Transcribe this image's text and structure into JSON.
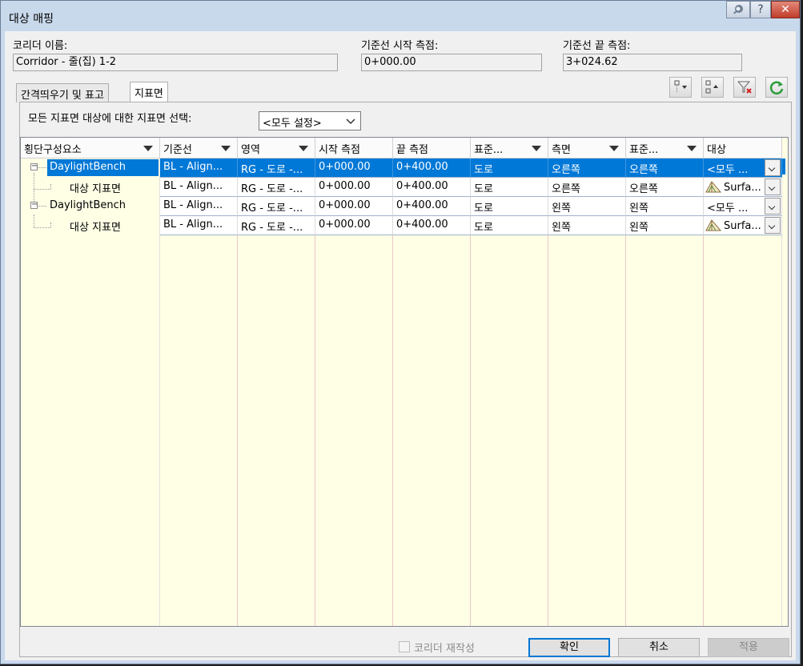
{
  "window": {
    "title": "대상 매핑",
    "help_button": "?",
    "close_button": "✕"
  },
  "fields": {
    "corridor_name_label": "코리더 이름:",
    "corridor_name_value": "Corridor - 줄(집) 1-2",
    "start_station_label": "기준선 시작 측점:",
    "start_station_value": "0+000.00",
    "end_station_label": "기준선 끝 측점:",
    "end_station_value": "3+024.62"
  },
  "tabs": [
    {
      "label": "간격띄우기 및 표고"
    },
    {
      "label": "지표면"
    }
  ],
  "toolbar": {
    "icons": [
      "expand-tree-icon",
      "collapse-tree-icon",
      "clear-filter-icon",
      "refresh-icon"
    ]
  },
  "surface_select": {
    "label": "모든 지표면 대상에 대한 지표면 선택:",
    "value": "<모두 설정>"
  },
  "grid": {
    "columns": [
      "횡단구성요소",
      "기준선",
      "영역",
      "시작 측점",
      "끝 측점",
      "표준...",
      "측면",
      "표준...",
      "대상"
    ],
    "rows": [
      {
        "level": 0,
        "name": "DaylightBench",
        "baseline": "BL - Align...",
        "region": "RG - 도로 -...",
        "start": "0+000.00",
        "end": "0+400.00",
        "assembly": "도로",
        "side": "오른쪽",
        "subassembly_side": "오른쪽",
        "target": "<모두 ...",
        "target_icon": false,
        "selected": true
      },
      {
        "level": 1,
        "name": "대상 지표면",
        "baseline": "BL - Align...",
        "region": "RG - 도로 -...",
        "start": "0+000.00",
        "end": "0+400.00",
        "assembly": "도로",
        "side": "오른쪽",
        "subassembly_side": "오른쪽",
        "target": "Surfa...",
        "target_icon": true,
        "selected": false
      },
      {
        "level": 0,
        "name": "DaylightBench",
        "baseline": "BL - Align...",
        "region": "RG - 도로 -...",
        "start": "0+000.00",
        "end": "0+400.00",
        "assembly": "도로",
        "side": "왼쪽",
        "subassembly_side": "왼쪽",
        "target": "<모두 ...",
        "target_icon": false,
        "selected": false
      },
      {
        "level": 1,
        "name": "대상 지표면",
        "baseline": "BL - Align...",
        "region": "RG - 도로 -...",
        "start": "0+000.00",
        "end": "0+400.00",
        "assembly": "도로",
        "side": "왼쪽",
        "subassembly_side": "왼쪽",
        "target": "Surfa...",
        "target_icon": true,
        "selected": false
      }
    ]
  },
  "footer": {
    "rebuild_label": "코리더 재작성",
    "ok_label": "확인",
    "cancel_label": "취소",
    "apply_label": "적용"
  },
  "colors": {
    "selection": "#0078d7",
    "grid_background": "#ffffe6",
    "title_bar": "#c9d9ec"
  }
}
